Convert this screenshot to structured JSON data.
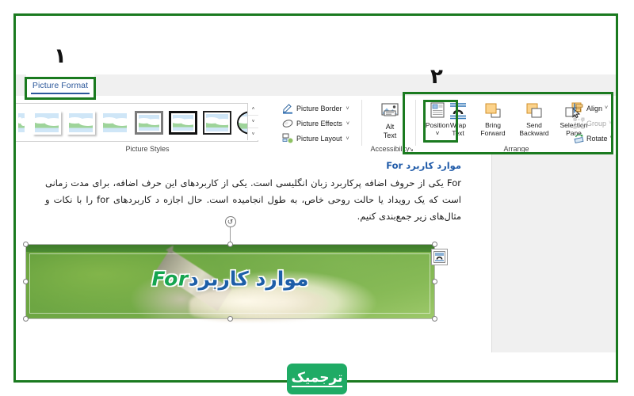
{
  "annotations": {
    "marker_one": "۱",
    "marker_two": "۲"
  },
  "ribbon": {
    "tabs": [
      {
        "label": "Picture Format",
        "active": true
      }
    ],
    "groups": [
      {
        "name": "Picture Styles",
        "label": "Picture Styles"
      },
      {
        "name": "Accessibility",
        "label": "Accessibility"
      },
      {
        "name": "Arrange",
        "label": "Arrange"
      }
    ],
    "picture_styles": {
      "label": "Picture Styles",
      "scroll_up": "˄",
      "scroll_down": "˅",
      "scroll_more": "˅"
    },
    "picture_commands": [
      {
        "label": "Picture Border",
        "icon": "pencil-border-icon",
        "caret": "˅"
      },
      {
        "label": "Picture Effects",
        "icon": "effects-icon",
        "caret": "˅"
      },
      {
        "label": "Picture Layout",
        "icon": "layout-icon",
        "caret": "˅"
      }
    ],
    "alt_text": {
      "label_line1": "Alt",
      "label_line2": "Text",
      "icon": "alt-text-icon",
      "group_label": "Accessibility",
      "dialog_launcher": "↘"
    },
    "arrange": {
      "group_label": "Arrange",
      "buttons": [
        {
          "label_line1": "Position",
          "label_line2": "",
          "caret": "˅",
          "icon": "position-icon"
        },
        {
          "label_line1": "Wrap",
          "label_line2": "Text",
          "caret": "˅",
          "icon": "wrap-text-icon"
        },
        {
          "label_line1": "Bring",
          "label_line2": "Forward",
          "caret": "˅",
          "icon": "bring-forward-icon"
        },
        {
          "label_line1": "Send",
          "label_line2": "Backward",
          "caret": "˅",
          "icon": "send-backward-icon"
        },
        {
          "label_line1": "Selection",
          "label_line2": "Pane",
          "caret": "",
          "icon": "selection-pane-icon"
        }
      ],
      "small_buttons": [
        {
          "label": "Align",
          "caret": "˅",
          "icon": "align-icon",
          "disabled": false
        },
        {
          "label": "Group",
          "caret": "˅",
          "icon": "group-icon",
          "disabled": true
        },
        {
          "label": "Rotate",
          "caret": "˅",
          "icon": "rotate-icon",
          "disabled": false
        }
      ]
    }
  },
  "document": {
    "heading": "موارد کاربرد For",
    "paragraph": "For یکی از حروف اضافه پرکاربرد زبان انگلیسی است. یکی از کاربردهای این حرف اضافه، برای مدت زمانی است که یک رویداد یا حالت روحی خاص، به طول انجامیده است. حال اجازه د کاربردهای for را با نکات و مثال‌های زیر جمع‌بندی کنیم.",
    "image": {
      "overlay_text_fa": "موارد کاربرد",
      "overlay_text_en": "For",
      "alt": "hand writing with pencil on green background",
      "layout_options_icon": "layout-options-icon",
      "rotate_handle_icon": "rotate-handle-icon"
    }
  },
  "logo": {
    "text": "ترجمیک"
  },
  "colors": {
    "frame_green": "#1a7a1f",
    "tab_blue": "#2b579a",
    "heading_blue": "#1f5aa8",
    "logo_green": "#1fab65",
    "overlay_fa": "#1d5fa8",
    "overlay_en": "#16a550"
  }
}
